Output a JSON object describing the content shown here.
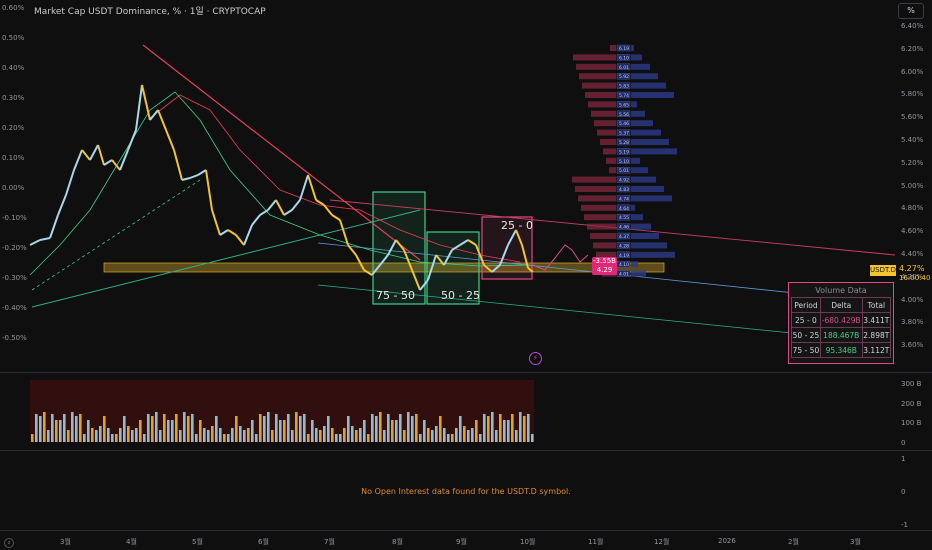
{
  "header": {
    "title": "Market Cap USDT Dominance, % · 1일 · CRYPTOCAP",
    "scale_button": "%"
  },
  "left_axis": [
    "0.60%",
    "0.50%",
    "0.40%",
    "0.30%",
    "0.20%",
    "0.10%",
    "0.00%",
    "-0.10%",
    "-0.20%",
    "-0.30%",
    "-0.40%",
    "-0.50%"
  ],
  "right_axis": [
    "6.40%",
    "6.20%",
    "6.00%",
    "5.80%",
    "5.60%",
    "5.40%",
    "5.20%",
    "5.00%",
    "4.80%",
    "4.60%",
    "4.40%",
    "4.20%",
    "4.00%",
    "3.80%",
    "3.60%"
  ],
  "volume_axis": [
    "300 B",
    "200 B",
    "100 B",
    "0"
  ],
  "oi_axis": [
    "1",
    "0",
    "-1"
  ],
  "x_axis": [
    "3월",
    "4월",
    "5월",
    "6월",
    "7월",
    "8월",
    "9월",
    "10월",
    "11월",
    "12월",
    "2026",
    "2월",
    "3월"
  ],
  "symbol": {
    "name": "USDT.D",
    "value": "4.27%",
    "countdown": "16:00:40"
  },
  "price_pill": {
    "delta": "-3.55B",
    "price": "4.29"
  },
  "boxes": [
    {
      "label": "75 - 50",
      "color": "#3fcf86"
    },
    {
      "label": "50 - 25",
      "color": "#3fcf86"
    },
    {
      "label": "25 - 0",
      "color": "#e04a8a"
    }
  ],
  "volume_table": {
    "title": "Volume Data",
    "headers": [
      "Period",
      "Delta",
      "Total"
    ],
    "rows": [
      {
        "period": "25 - 0",
        "delta": "-680.429B",
        "total": "3.411T",
        "sign": "neg"
      },
      {
        "period": "50 - 25",
        "delta": "188.467B",
        "total": "2.898T",
        "sign": "pos"
      },
      {
        "period": "75 - 50",
        "delta": "95.346B",
        "total": "3.112T",
        "sign": "pos"
      }
    ]
  },
  "oi_message": "No Open Interest data found for the USDT.D symbol.",
  "profile_labels": [
    "6.19",
    "6.10",
    "6.01",
    "5.92",
    "5.83",
    "5.74",
    "5.65",
    "5.56",
    "5.46",
    "5.37",
    "5.28",
    "5.19",
    "5.10",
    "5.01",
    "4.92",
    "4.83",
    "4.74",
    "4.64",
    "4.55",
    "4.46",
    "4.37",
    "4.28",
    "4.19",
    "4.10",
    "4.01"
  ],
  "colors": {
    "up": "#f4c430",
    "down": "#a8d8ea",
    "bull": "#3fcf86",
    "bear": "#e04a8a",
    "trend": "#e8405a"
  }
}
